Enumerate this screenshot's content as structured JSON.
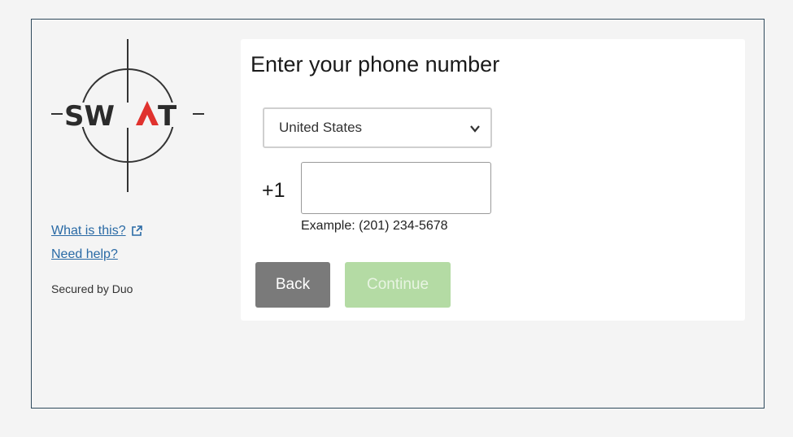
{
  "sidebar": {
    "logo_text": "SWAT",
    "links": [
      {
        "label": "What is this?",
        "icon": "external-link-icon"
      },
      {
        "label": "Need help?"
      }
    ],
    "secured_by": "Secured by Duo"
  },
  "main": {
    "title": "Enter your phone number",
    "country": {
      "selected": "United States",
      "icon": "chevron-down-icon"
    },
    "phone": {
      "prefix": "+1",
      "value": "",
      "example": "Example: (201) 234-5678"
    },
    "buttons": {
      "back_label": "Back",
      "continue_label": "Continue"
    }
  },
  "colors": {
    "link": "#2a6aa5",
    "back_button": "#7a7a7a",
    "continue_button_disabled": "#b4dba4",
    "frame_border": "#2f4a5c",
    "logo_red": "#e0322e"
  }
}
